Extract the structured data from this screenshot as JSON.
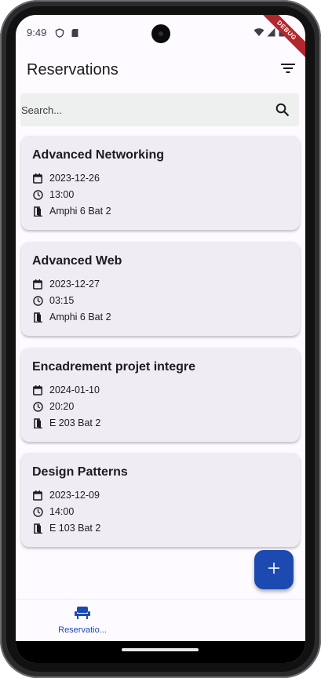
{
  "status_bar": {
    "time": "9:49",
    "debug_label": "DEBUG"
  },
  "app_bar": {
    "title": "Reservations",
    "filter_icon": "filter-list-icon"
  },
  "search": {
    "placeholder": "Search...",
    "icon": "search-icon"
  },
  "reservations": [
    {
      "title": "Advanced Networking",
      "date": "2023-12-26",
      "time": "13:00",
      "room": "Amphi 6 Bat 2"
    },
    {
      "title": "Advanced Web",
      "date": "2023-12-27",
      "time": "03:15",
      "room": "Amphi 6 Bat 2"
    },
    {
      "title": "Encadrement projet integre",
      "date": "2024-01-10",
      "time": "20:20",
      "room": "E 203 Bat 2"
    },
    {
      "title": "Design Patterns",
      "date": "2023-12-09",
      "time": "14:00",
      "room": "E 103 Bat 2"
    }
  ],
  "fab": {
    "icon": "add-icon"
  },
  "bottom_nav": {
    "items": [
      {
        "label": "Reservatio...",
        "icon": "chair-icon"
      }
    ]
  },
  "colors": {
    "accent": "#1d4ab0",
    "card_bg": "#f0ecf4",
    "screen_bg": "#fdfbff",
    "search_bg": "#eef0ef",
    "debug_ribbon": "#b3262d"
  }
}
